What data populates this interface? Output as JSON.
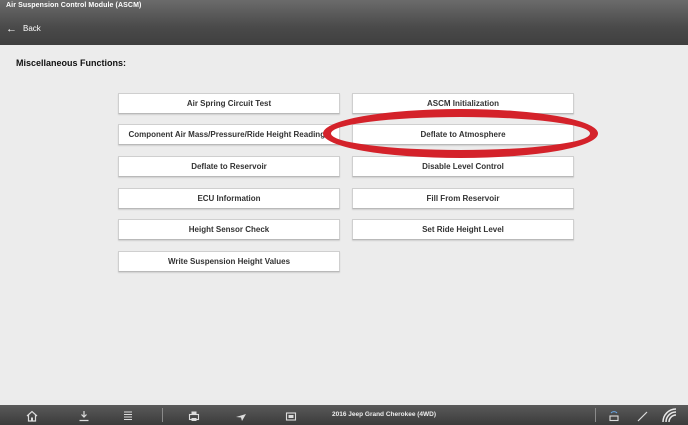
{
  "header": {
    "title": "Air Suspension Control Module (ASCM)",
    "back_label": "Back"
  },
  "main": {
    "section_title": "Miscellaneous Functions:",
    "left_buttons": [
      "Air Spring Circuit Test",
      "Component Air Mass/Pressure/Ride Height Readings",
      "Deflate to Reservoir",
      "ECU Information",
      "Height Sensor Check",
      "Write Suspension Height Values"
    ],
    "right_buttons": [
      "ASCM Initialization",
      "Deflate to Atmosphere",
      "Disable Level Control",
      "Fill From Reservoir",
      "Set Ride Height Level"
    ],
    "highlight_color": "#d4222a"
  },
  "bottom_bar": {
    "vehicle": "2016 Jeep Grand Cherokee (4WD)",
    "icons": [
      "home-icon",
      "download-icon",
      "list-icon",
      "print-icon",
      "plane-icon",
      "folder-icon",
      "obd-icon",
      "pencil-icon",
      "wifi-icon"
    ]
  }
}
